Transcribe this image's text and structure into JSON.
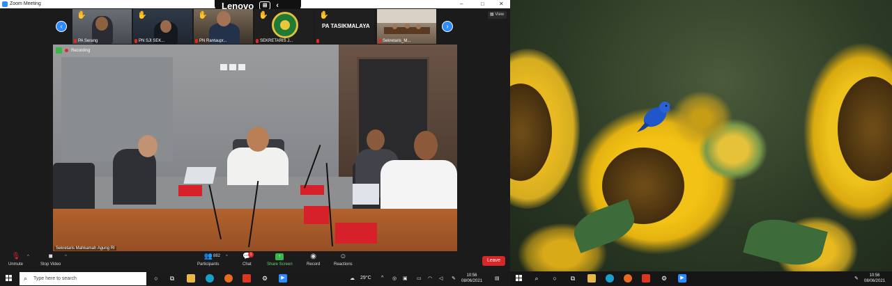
{
  "window": {
    "title": "Zoom Meeting",
    "controls": [
      "–",
      "□",
      "✕"
    ]
  },
  "lenovo_bar": {
    "label": "Lenovo"
  },
  "view_label": "View",
  "gallery": [
    {
      "name": "PA Serang",
      "raised_hand": true
    },
    {
      "name": "PN SJI SEK...",
      "raised_hand": true
    },
    {
      "name": "PN Rantaupr...",
      "raised_hand": true
    },
    {
      "name": "SEKRETARIS J...",
      "raised_hand": true
    },
    {
      "name": "PA TASIKMALAYA",
      "raised_hand": true
    },
    {
      "name": "Sekretaris_M...",
      "raised_hand": false
    }
  ],
  "main_video": {
    "recording_label": "Recording",
    "speaker_name": "Sekretaris Mahkamah Agung RI"
  },
  "toolbar": {
    "unmute": "Unmute",
    "stop_video": "Stop Video",
    "participants": "Participants",
    "participant_count": "882",
    "chat": "Chat",
    "chat_badge": "1",
    "share_screen": "Share Screen",
    "record": "Record",
    "reactions": "Reactions",
    "leave": "Leave"
  },
  "taskbar_left": {
    "search_placeholder": "Type here to search",
    "weather": "29°C",
    "time": "10:56",
    "date": "08/06/2021"
  },
  "taskbar_right": {
    "time": "10:56",
    "date": "08/06/2021"
  },
  "colors": {
    "zoom_blue": "#2d8cff",
    "leave_red": "#d62828",
    "share_green": "#3ab54a"
  }
}
